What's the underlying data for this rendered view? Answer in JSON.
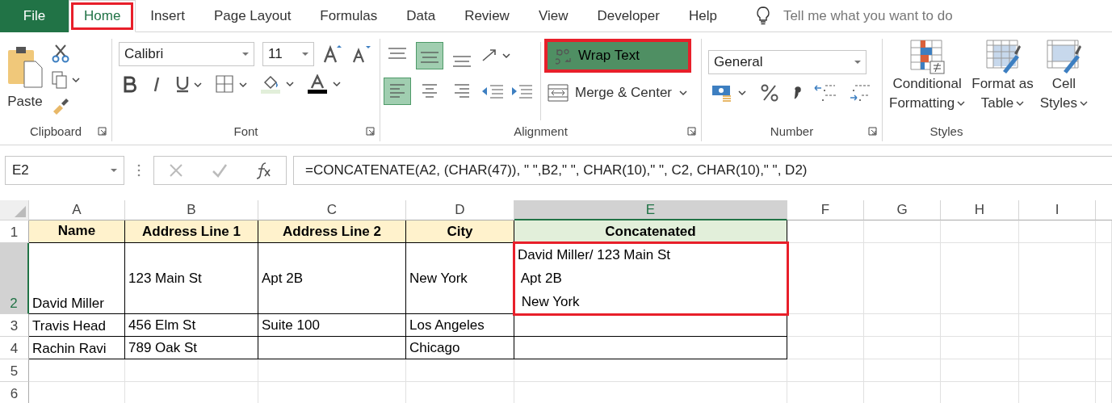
{
  "tabs": [
    {
      "label": "File",
      "kind": "file",
      "selected": false,
      "annotated": false
    },
    {
      "label": "Home",
      "kind": "tab",
      "selected": true,
      "annotated": true
    },
    {
      "label": "Insert",
      "kind": "tab",
      "selected": false,
      "annotated": false
    },
    {
      "label": "Page Layout",
      "kind": "tab",
      "selected": false,
      "annotated": false
    },
    {
      "label": "Formulas",
      "kind": "tab",
      "selected": false,
      "annotated": false
    },
    {
      "label": "Data",
      "kind": "tab",
      "selected": false,
      "annotated": false
    },
    {
      "label": "Review",
      "kind": "tab",
      "selected": false,
      "annotated": false
    },
    {
      "label": "View",
      "kind": "tab",
      "selected": false,
      "annotated": false
    },
    {
      "label": "Developer",
      "kind": "tab",
      "selected": false,
      "annotated": false
    },
    {
      "label": "Help",
      "kind": "tab",
      "selected": false,
      "annotated": false
    }
  ],
  "tell_me": {
    "placeholder": "Tell me what you want to do"
  },
  "clipboard": {
    "paste_label": "Paste",
    "group_label": "Clipboard"
  },
  "font": {
    "name": "Calibri",
    "size": "11",
    "group_label": "Font"
  },
  "alignment": {
    "vertical": [
      {
        "kind": "top",
        "selected": false
      },
      {
        "kind": "middle",
        "selected": true
      },
      {
        "kind": "bottom",
        "selected": false
      }
    ],
    "horizontal": [
      {
        "kind": "left",
        "selected": true
      },
      {
        "kind": "center",
        "selected": false
      },
      {
        "kind": "right",
        "selected": false
      }
    ],
    "wrap_text": {
      "label": "Wrap Text",
      "on": true,
      "annotated": true
    },
    "merge": {
      "label": "Merge & Center"
    },
    "group_label": "Alignment"
  },
  "number": {
    "format": "General",
    "group_label": "Number"
  },
  "styles": {
    "buttons": [
      {
        "kind": "conditional",
        "lines": [
          "Conditional",
          "Formatting"
        ]
      },
      {
        "kind": "table",
        "lines": [
          "Format as",
          "Table"
        ]
      },
      {
        "kind": "cell",
        "lines": [
          "Cell",
          "Styles"
        ]
      }
    ],
    "group_label": "Styles"
  },
  "formula_bar": {
    "name_box": "E2",
    "formula": "=CONCATENATE(A2, (CHAR(47)), \" \",B2,\" \", CHAR(10),\" \", C2, CHAR(10),\" \", D2)"
  },
  "sheet": {
    "columns": [
      {
        "label": "A",
        "selected": false
      },
      {
        "label": "B",
        "selected": false
      },
      {
        "label": "C",
        "selected": false
      },
      {
        "label": "D",
        "selected": false
      },
      {
        "label": "E",
        "selected": true
      },
      {
        "label": "F",
        "selected": false
      },
      {
        "label": "G",
        "selected": false
      },
      {
        "label": "H",
        "selected": false
      },
      {
        "label": "I",
        "selected": false
      }
    ],
    "rows": [
      {
        "label": "1",
        "selected": false,
        "cells": [
          {
            "text": "Name",
            "kind": "header",
            "color": "#fff2cc"
          },
          {
            "text": "Address Line 1",
            "kind": "header",
            "color": "#fff2cc"
          },
          {
            "text": "Address Line 2",
            "kind": "header",
            "color": "#fff2cc"
          },
          {
            "text": "City",
            "kind": "header",
            "color": "#fff2cc"
          },
          {
            "text": "Concatenated",
            "kind": "header",
            "color": "#e2efda"
          }
        ]
      },
      {
        "label": "2",
        "selected": true,
        "cells": [
          {
            "text": "David Miller"
          },
          {
            "text": "123 Main St"
          },
          {
            "text": "Apt 2B"
          },
          {
            "text": "New York"
          },
          {
            "lines": [
              "David Miller/ 123 Main St",
              " Apt 2B",
              " New York"
            ],
            "annotated": true
          }
        ]
      },
      {
        "label": "3",
        "selected": false,
        "cells": [
          {
            "text": "Travis Head"
          },
          {
            "text": "456 Elm St"
          },
          {
            "text": "Suite 100"
          },
          {
            "text": "Los Angeles"
          },
          {}
        ]
      },
      {
        "label": "4",
        "selected": false,
        "cells": [
          {
            "text": "Rachin Ravi"
          },
          {
            "text": "789 Oak St"
          },
          {},
          {
            "text": "Chicago"
          },
          {}
        ]
      },
      {
        "label": "5",
        "selected": false,
        "cells": []
      },
      {
        "label": "6",
        "selected": false,
        "cells": []
      }
    ]
  }
}
